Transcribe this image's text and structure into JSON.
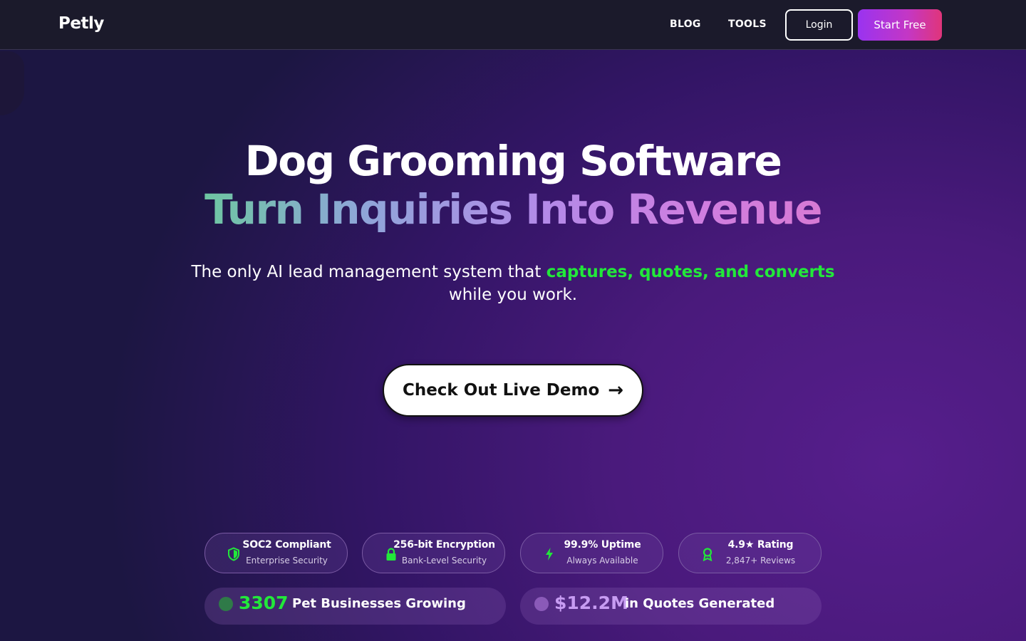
{
  "nav": {
    "logo": "Petly",
    "links": [
      "BLOG",
      "TOOLS"
    ],
    "login_label": "Login",
    "start_label": "Start Free"
  },
  "hero": {
    "title": "Dog Grooming Software",
    "subtitle": "Turn Inquiries Into Revenue",
    "tagline_prefix": "The only AI lead management system that ",
    "tagline_highlight": "captures, quotes, and converts",
    "tagline_suffix": " while you work.",
    "cta_label": "Check Out Live Demo",
    "cta_arrow": "→"
  },
  "badges": [
    {
      "icon": "shield-icon",
      "title": "SOC2 Compliant",
      "subtitle": "Enterprise Security"
    },
    {
      "icon": "lock-icon",
      "title": "256-bit Encryption",
      "subtitle": "Bank-Level Security"
    },
    {
      "icon": "lightning-icon",
      "title": "99.9% Uptime",
      "subtitle": "Always Available"
    },
    {
      "icon": "award-icon",
      "title": "4.9★ Rating",
      "subtitle": "2,847+ Reviews"
    }
  ],
  "stats": [
    {
      "value": "3307",
      "label": "Pet Businesses Growing"
    },
    {
      "value": "$12.2M",
      "label": "in Quotes Generated"
    }
  ],
  "colors": {
    "accent_green": "#22e83a",
    "accent_purple": "#9a33f0",
    "accent_pink": "#e0357a",
    "navbar_bg": "#1b1a2b"
  }
}
